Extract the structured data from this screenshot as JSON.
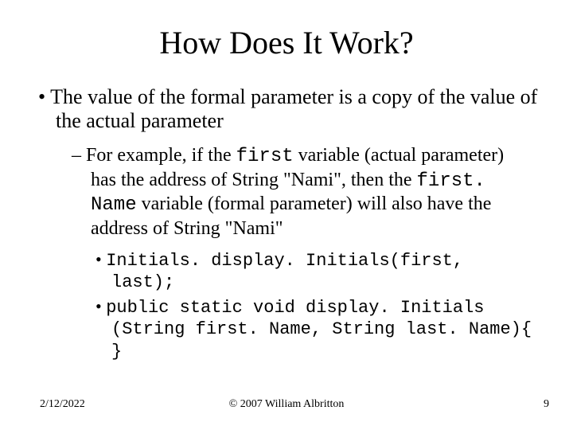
{
  "title": "How Does It Work?",
  "bullet1_text": "The value of the formal parameter is a copy of the value of the actual parameter",
  "sub_pre": "For example, if the ",
  "sub_code1": "first",
  "sub_mid1": " variable (actual parameter) has the address of String \"Nami\", then the ",
  "sub_code2": "first. Name",
  "sub_mid2": " variable (formal parameter) will also have the address of String \"Nami\"",
  "code1": "Initials. display. Initials(first, last);",
  "code2": "public static void display. Initials (String first. Name, String last. Name){ }",
  "footer_date": "2/12/2022",
  "footer_copyright": "© 2007 William Albritton",
  "footer_page": "9"
}
